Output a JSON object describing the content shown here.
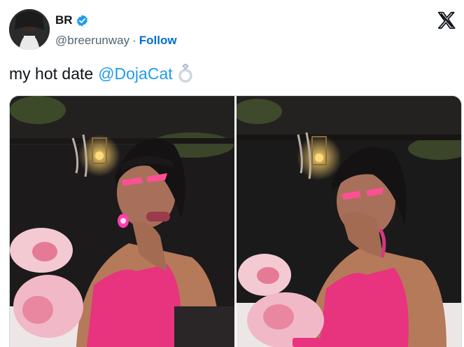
{
  "author": {
    "name": "BR",
    "handle": "@breerunway",
    "separator": "·",
    "follow_label": "Follow",
    "verified_icon": "verified-badge-icon",
    "verified_color": "#1d9bf0"
  },
  "platform_icon": "x-logo-icon",
  "tweet": {
    "text": "my hot date",
    "mention": "@DojaCat",
    "emoji_icon": "ring-icon"
  },
  "colors": {
    "link": "#1d9bf0",
    "follow": "#006fd6",
    "text": "#0f1419",
    "muted": "#536471",
    "accent_pink": "#e8337f"
  },
  "media": {
    "photo_count": 2
  }
}
